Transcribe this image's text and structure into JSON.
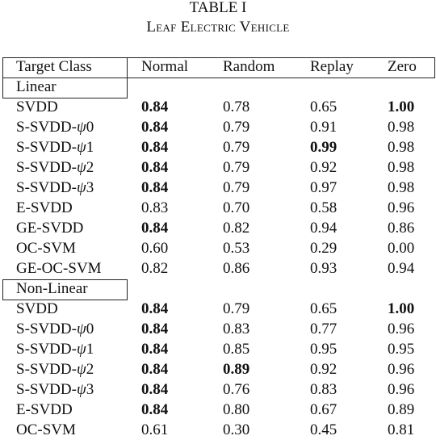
{
  "caption": {
    "label": "TABLE I",
    "title": "Leaf Electric Vehicle"
  },
  "columns": [
    "Target Class",
    "Normal",
    "Random",
    "Replay",
    "Zero"
  ],
  "sections": [
    {
      "label": "Linear",
      "rows": [
        {
          "method": "SVDD",
          "values": [
            "0.84",
            "0.78",
            "0.65",
            "1.00"
          ],
          "bold": [
            true,
            false,
            false,
            true
          ]
        },
        {
          "method_prefix": "S-SVDD-",
          "method_psi": "ψ",
          "method_suffix": "0",
          "values": [
            "0.84",
            "0.79",
            "0.91",
            "0.98"
          ],
          "bold": [
            true,
            false,
            false,
            false
          ]
        },
        {
          "method_prefix": "S-SVDD-",
          "method_psi": "ψ",
          "method_suffix": "1",
          "values": [
            "0.84",
            "0.79",
            "0.99",
            "0.98"
          ],
          "bold": [
            true,
            false,
            true,
            false
          ]
        },
        {
          "method_prefix": "S-SVDD-",
          "method_psi": "ψ",
          "method_suffix": "2",
          "values": [
            "0.84",
            "0.79",
            "0.92",
            "0.98"
          ],
          "bold": [
            true,
            false,
            false,
            false
          ]
        },
        {
          "method_prefix": "S-SVDD-",
          "method_psi": "ψ",
          "method_suffix": "3",
          "values": [
            "0.84",
            "0.79",
            "0.97",
            "0.98"
          ],
          "bold": [
            true,
            false,
            false,
            false
          ]
        },
        {
          "method": "E-SVDD",
          "values": [
            "0.83",
            "0.70",
            "0.58",
            "0.96"
          ],
          "bold": [
            false,
            false,
            false,
            false
          ]
        },
        {
          "method": "GE-SVDD",
          "values": [
            "0.84",
            "0.82",
            "0.94",
            "0.86"
          ],
          "bold": [
            true,
            false,
            false,
            false
          ]
        },
        {
          "method": "OC-SVM",
          "values": [
            "0.60",
            "0.53",
            "0.29",
            "0.00"
          ],
          "bold": [
            false,
            false,
            false,
            false
          ]
        },
        {
          "method": "GE-OC-SVM",
          "values": [
            "0.82",
            "0.86",
            "0.93",
            "0.94"
          ],
          "bold": [
            false,
            false,
            false,
            false
          ]
        }
      ]
    },
    {
      "label": "Non-Linear",
      "rows": [
        {
          "method": "SVDD",
          "values": [
            "0.84",
            "0.79",
            "0.65",
            "1.00"
          ],
          "bold": [
            true,
            false,
            false,
            true
          ]
        },
        {
          "method_prefix": "S-SVDD-",
          "method_psi": "ψ",
          "method_suffix": "0",
          "values": [
            "0.84",
            "0.83",
            "0.77",
            "0.96"
          ],
          "bold": [
            true,
            false,
            false,
            false
          ]
        },
        {
          "method_prefix": "S-SVDD-",
          "method_psi": "ψ",
          "method_suffix": "1",
          "values": [
            "0.84",
            "0.85",
            "0.95",
            "0.95"
          ],
          "bold": [
            true,
            false,
            false,
            false
          ]
        },
        {
          "method_prefix": "S-SVDD-",
          "method_psi": "ψ",
          "method_suffix": "2",
          "values": [
            "0.84",
            "0.89",
            "0.92",
            "0.96"
          ],
          "bold": [
            true,
            true,
            false,
            false
          ]
        },
        {
          "method_prefix": "S-SVDD-",
          "method_psi": "ψ",
          "method_suffix": "3",
          "values": [
            "0.84",
            "0.76",
            "0.83",
            "0.96"
          ],
          "bold": [
            true,
            false,
            false,
            false
          ]
        },
        {
          "method": "E-SVDD",
          "values": [
            "0.84",
            "0.80",
            "0.67",
            "0.89"
          ],
          "bold": [
            true,
            false,
            false,
            false
          ]
        },
        {
          "method": "OC-SVM",
          "values": [
            "0.61",
            "0.30",
            "0.45",
            "0.81"
          ],
          "bold": [
            false,
            false,
            false,
            false
          ]
        }
      ]
    }
  ]
}
